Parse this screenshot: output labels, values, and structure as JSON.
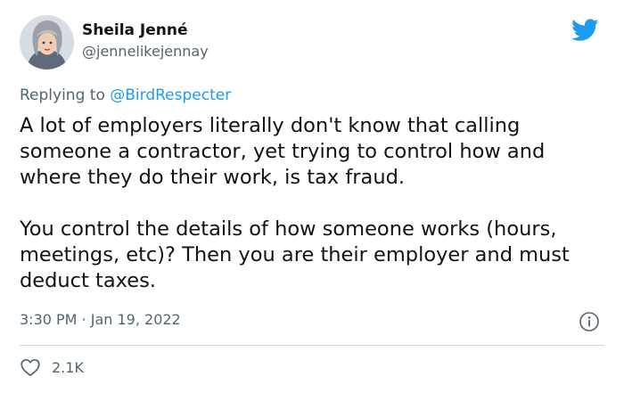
{
  "tweet": {
    "author": {
      "display_name": "Sheila Jenné",
      "handle": "@jennelikejennay",
      "avatar": "avatar-illustration"
    },
    "platform_icon": "twitter-bird-icon",
    "reply_prefix": "Replying to",
    "reply_mention": "@BirdRespecter",
    "text_paragraphs": [
      "A lot of employers literally don't know that calling someone a contractor, yet trying to control how and where they do their work, is tax fraud.",
      "You control the details of how someone works (hours, meetings, etc)? Then you are their employer and must deduct taxes."
    ],
    "timestamp": "3:30 PM · Jan 19, 2022",
    "like_count": "2.1K"
  },
  "colors": {
    "twitter_blue": "#1d9bf0",
    "secondary_text": "#536471",
    "primary_text": "#0f1419",
    "divider": "#cfd9de"
  }
}
